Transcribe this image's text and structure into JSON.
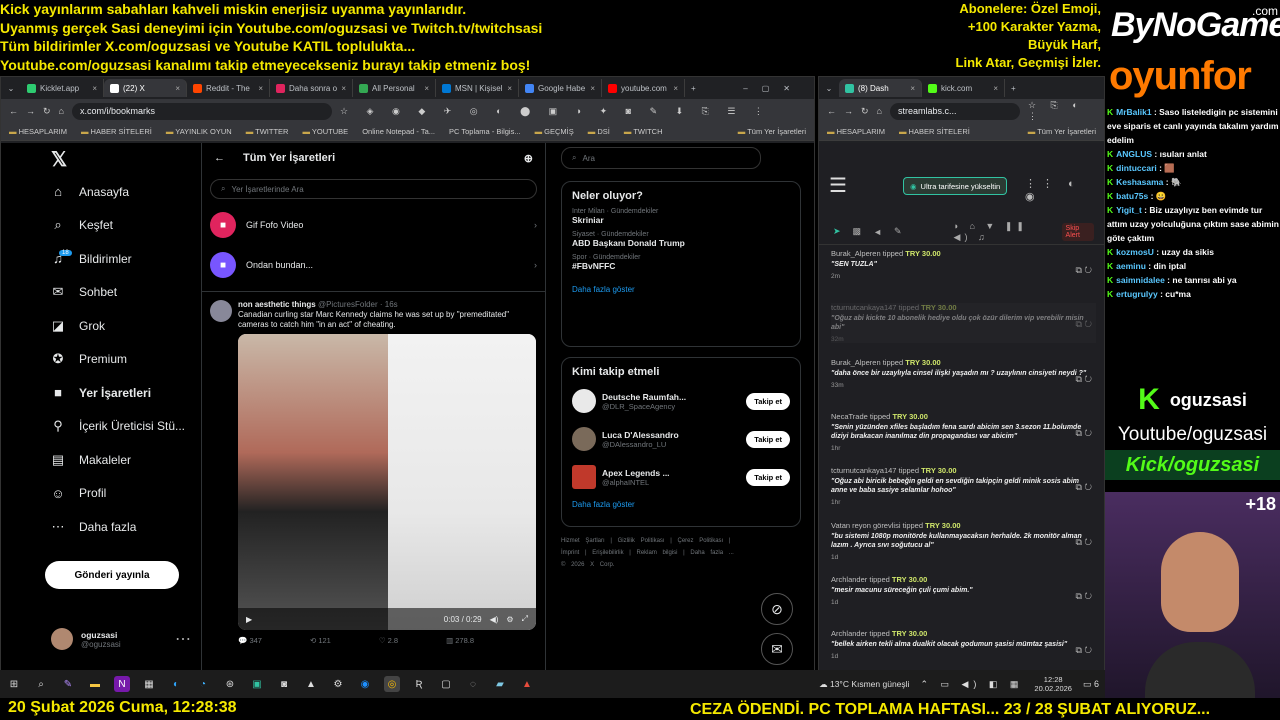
{
  "overlay": {
    "top_lines": [
      "Kick yayınlarım sabahları kahveli miskin enerjisiz uyanma yayınlarıdır.",
      "Uyanmış gerçek Sasi deneyimi için Youtube.com/oguzsasi ve Twitch.tv/twitchsasi",
      "Tüm bildirimler X.com/oguzsasi ve Youtube KATIL toplulukta...",
      "Youtube.com/oguzsasi kanalımı takip etmeyecekseniz burayı takip etmeniz boş!"
    ],
    "right_lines": [
      "Abonelere: Özel Emoji,",
      "+100 Karakter Yazma,",
      "Büyük Harf,",
      "Link Atar, Geçmişi İzler."
    ],
    "brand_top": "ByNoGame",
    "brand_com": ".com",
    "brand_bottom": "oyunfor",
    "bottom_left": "20 Şubat 2026 Cuma, 12:28:38",
    "bottom_right": "CEZA ÖDENDİ. PC TOPLAMA HAFTASI... 23 / 28 ŞUBAT ALIYORUZ...",
    "kick_name": "oguzsasi",
    "youtube_text": "Youtube/oguzsasi",
    "kick_text": "Kick/oguzsasi",
    "viewer_badge": "+18"
  },
  "browser1": {
    "tabs": [
      "Kicklet.app",
      "(22) X",
      "Reddit - The",
      "Daha sonra o",
      "All Personal",
      "MSN | Kişisel",
      "Google Habe",
      "youtube.com"
    ],
    "url": "x.com/i/bookmarks",
    "bookmarks": [
      "HESAPLARIM",
      "HABER SİTELERİ",
      "YAYINLIK OYUN",
      "TWITTER",
      "YOUTUBE",
      "Online Notepad - Ta...",
      "PC Toplama - Bilgis...",
      "GEÇMİŞ",
      "DSİ",
      "TWITCH",
      "Tüm Yer İşaretleri"
    ]
  },
  "x": {
    "nav": [
      {
        "icon": "home-icon",
        "glyph": "⌂",
        "label": "Anasayfa"
      },
      {
        "icon": "search-icon",
        "glyph": "⌕",
        "label": "Keşfet"
      },
      {
        "icon": "bell-icon",
        "glyph": "♫",
        "label": "Bildirimler"
      },
      {
        "icon": "mail-icon",
        "glyph": "✉",
        "label": "Sohbet"
      },
      {
        "icon": "grok-icon",
        "glyph": "◪",
        "label": "Grok"
      },
      {
        "icon": "premium-icon",
        "glyph": "✪",
        "label": "Premium"
      },
      {
        "icon": "bookmark-icon",
        "glyph": "■",
        "label": "Yer İşaretleri"
      },
      {
        "icon": "creator-icon",
        "glyph": "⚲",
        "label": "İçerik Üreticisi Stü..."
      },
      {
        "icon": "article-icon",
        "glyph": "▤",
        "label": "Makaleler"
      },
      {
        "icon": "profile-icon",
        "glyph": "☺",
        "label": "Profil"
      },
      {
        "icon": "more-icon",
        "glyph": "⋯",
        "label": "Daha fazla"
      }
    ],
    "notif_badge": "18",
    "post_button": "Gönderi yayınla",
    "account_name": "oguzsasi",
    "account_handle": "@oguzsasi",
    "header": "Tüm Yer İşaretleri",
    "search_placeholder": "Yer İşaretlerinde Ara",
    "folders": [
      "Gif Fofo Video",
      "Ondan bundan..."
    ],
    "tweet": {
      "name": "non aesthetic things",
      "handle": "@PicturesFolder · 16s",
      "text": "Canadian curling star Marc Kennedy claims he was set up by \"premeditated\" cameras to catch him \"in an act\" of cheating.",
      "time": "0:03 / 0:29",
      "replies": "347",
      "retweets": "121",
      "likes": "2.8",
      "views": "278.8"
    },
    "right_search": "Ara",
    "trending_title": "Neler oluyor?",
    "trends": [
      {
        "cat": "Inter Milan · Gündemdekiler",
        "title": "Skriniar"
      },
      {
        "cat": "Siyaset · Gündemdekiler",
        "title": "ABD Başkanı Donald Trump"
      },
      {
        "cat": "Spor · Gündemdekiler",
        "title": "#FBvNFFC"
      }
    ],
    "show_more": "Daha fazla göster",
    "who_title": "Kimi takip etmeli",
    "who": [
      {
        "name": "Deutsche Raumfah...",
        "handle": "@DLR_SpaceAgency",
        "color": "#e9e9e9"
      },
      {
        "name": "Luca D'Alessandro",
        "handle": "@DAlessandro_LU",
        "color": "#7a6a5a"
      },
      {
        "name": "Apex Legends ...",
        "handle": "@alphaINTEL",
        "color": "#c0392b"
      }
    ],
    "follow": "Takip et",
    "footer": [
      "Hizmet Şartları",
      "Gizlilik Politikası",
      "Çerez Politikası",
      "İmprint",
      "Erişilebilirlik",
      "Reklam bilgisi",
      "Daha fazla ...",
      "© 2026 X Corp."
    ]
  },
  "browser2": {
    "tabs": [
      "(8) Dash",
      "kick.com"
    ],
    "url": "streamlabs.c...",
    "bookmarks": [
      "HESAPLARIM",
      "HABER SİTELERİ",
      "Tüm Yer İşaretleri"
    ],
    "upgrade": "Ultra tarifesine yükseltin",
    "skip_alert": "Skip Alert",
    "tips": [
      {
        "user": "Burak_Alperen",
        "amount": "TRY 30.00",
        "msg": "\"SEN TUZLA\"",
        "time": "2m",
        "faded": false
      },
      {
        "user": "tcturnutcankaya147",
        "amount": "TRY 30.00",
        "msg": "\"Oğuz abi kickte 10 abonelik hediye oldu çok özür dilerim vip verebilir misin abi\"",
        "time": "32m",
        "faded": true
      },
      {
        "user": "Burak_Alperen",
        "amount": "TRY 30.00",
        "msg": "\"daha önce bir uzaylıyla cinsel ilişki yaşadın mı ? uzaylının cinsiyeti neydi ?\"",
        "time": "33m",
        "faded": false
      },
      {
        "user": "NecaTrade",
        "amount": "TRY 30.00",
        "msg": "\"Senin yüzünden xfiles başladım fena sardı abicim sen 3.sezon 11.bolumde diziyi bırakacan inanılmaz din propagandası var abicim\"",
        "time": "1hr",
        "faded": false
      },
      {
        "user": "tcturnutcankaya147",
        "amount": "TRY 30.00",
        "msg": "\"Oğuz abi biricik bebeğin geldi en sevdiğin takipçin geldi minik sosis abim anne ve baba sasiye selamlar hohoo\"",
        "time": "1hr",
        "faded": false
      },
      {
        "user": "Vatan reyon görevlisi",
        "amount": "TRY 30.00",
        "msg": "\"bu sistemi 1080p monitörde kullanmayacaksın herhalde. 2k monitör alman lazım . Ayrıca sıvı soğutucu al\"",
        "time": "1d",
        "faded": false
      },
      {
        "user": "Archlander",
        "amount": "TRY 30.00",
        "msg": "\"mesir macunu süreceğin çuli çumi abim.\"",
        "time": "1d",
        "faded": false
      },
      {
        "user": "Archlander",
        "amount": "TRY 30.00",
        "msg": "\"bellek airken tekli alma dualkit olacak godumun şasisi mümtaz şasisi\"",
        "time": "1d",
        "faded": false
      }
    ],
    "tipped": "tipped"
  },
  "chat": [
    {
      "user": "MrBalik1",
      "text": "Saso listeledigin pc sistemini eve siparis et canlı yayında takalım yardım edelim"
    },
    {
      "user": "ANGLUS",
      "text": "ısuları anlat"
    },
    {
      "user": "dintuccari",
      "text": "🟫"
    },
    {
      "user": "Keshasama",
      "text": "🐘"
    },
    {
      "user": "batu75s",
      "text": "😀"
    },
    {
      "user": "Yigit_t",
      "text": "Biz uzaylıyız ben evimde tur attım uzay yolculuğuna çıktım sase abimin göte çaktım"
    },
    {
      "user": "kozmosU",
      "text": "uzay da sikis"
    },
    {
      "user": "aeminu",
      "text": "din iptal"
    },
    {
      "user": "saimnidalee",
      "text": "ne tanrısı abi ya"
    },
    {
      "user": "ertugrulyy",
      "text": "cu*ma"
    }
  ],
  "taskbar": {
    "weather": "13°C  Kısmen güneşli",
    "time": "12:28",
    "date": "20.02.2026",
    "notif": "6"
  }
}
